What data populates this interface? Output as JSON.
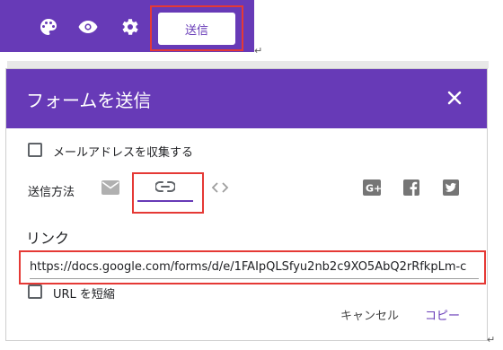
{
  "toolbar": {
    "icons": [
      "palette-icon",
      "eye-icon",
      "gear-icon"
    ],
    "send_label": "送信"
  },
  "dialog": {
    "title": "フォームを送信",
    "collect_email_label": "メールアドレスを収集する",
    "send_method_label": "送信方法",
    "link_heading": "リンク",
    "url": "https://docs.google.com/forms/d/e/1FAIpQLSfyu2nb2c9XO5AbQ2rRfkpLm-c",
    "shorten_url_label": "URL を短縮",
    "cancel_label": "キャンセル",
    "copy_label": "コピー"
  },
  "colors": {
    "brand": "#673ab7",
    "highlight": "#e53935",
    "icon_gray": "#5f6368"
  }
}
